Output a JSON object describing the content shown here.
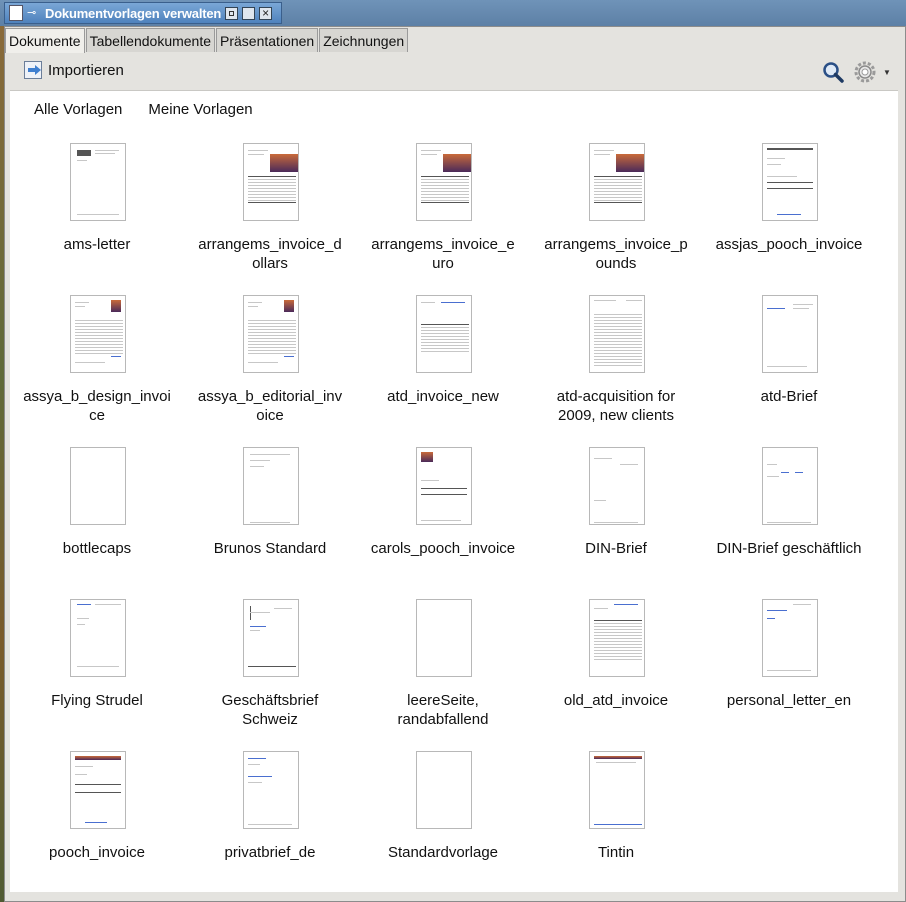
{
  "window": {
    "title": "Dokumentvorlagen verwalten"
  },
  "tabs": [
    {
      "label": "Dokumente",
      "active": true
    },
    {
      "label": "Tabellendokumente",
      "active": false
    },
    {
      "label": "Präsentationen",
      "active": false
    },
    {
      "label": "Zeichnungen",
      "active": false
    }
  ],
  "toolbar": {
    "import_label": "Importieren",
    "search_icon": "search-icon",
    "settings_icon": "gear-icon"
  },
  "filters": {
    "all": "Alle Vorlagen",
    "mine": "Meine Vorlagen"
  },
  "templates": [
    {
      "label": "ams-letter",
      "style": "letter"
    },
    {
      "label": "arrangems_invoice_d\nollars",
      "style": "invoice-img"
    },
    {
      "label": "arrangems_invoice_e\nuro",
      "style": "invoice-img"
    },
    {
      "label": "arrangems_invoice_p\nounds",
      "style": "invoice-img"
    },
    {
      "label": "assjas_pooch_invoice",
      "style": "pooch"
    },
    {
      "label": "assya_b_design_invoi\nce",
      "style": "assya"
    },
    {
      "label": "assya_b_editorial_inv\noice",
      "style": "assya"
    },
    {
      "label": "atd_invoice_new",
      "style": "table"
    },
    {
      "label": "atd-acquisition for\n2009, new clients",
      "style": "text"
    },
    {
      "label": "atd-Brief",
      "style": "brief"
    },
    {
      "label": "bottlecaps",
      "style": "blank"
    },
    {
      "label": "Brunos Standard",
      "style": "faint"
    },
    {
      "label": "carols_pooch_invoice",
      "style": "carols"
    },
    {
      "label": "DIN-Brief",
      "style": "din"
    },
    {
      "label": "DIN-Brief geschäftlich",
      "style": "din2"
    },
    {
      "label": "Flying Strudel",
      "style": "flying"
    },
    {
      "label": "Geschäftsbrief\nSchweiz",
      "style": "schweiz"
    },
    {
      "label": "leereSeite,\nrandabfallend",
      "style": "blank"
    },
    {
      "label": "old_atd_invoice",
      "style": "oldatd"
    },
    {
      "label": "personal_letter_en",
      "style": "personal"
    },
    {
      "label": "pooch_invoice",
      "style": "pooch2"
    },
    {
      "label": "privatbrief_de",
      "style": "privat"
    },
    {
      "label": "Standardvorlage",
      "style": "blank"
    },
    {
      "label": "Tintin",
      "style": "tintin"
    }
  ],
  "colors": {
    "titlebar": "#4f82bd",
    "content_bg": "#ffffff",
    "window_bg": "#e4e3df"
  }
}
